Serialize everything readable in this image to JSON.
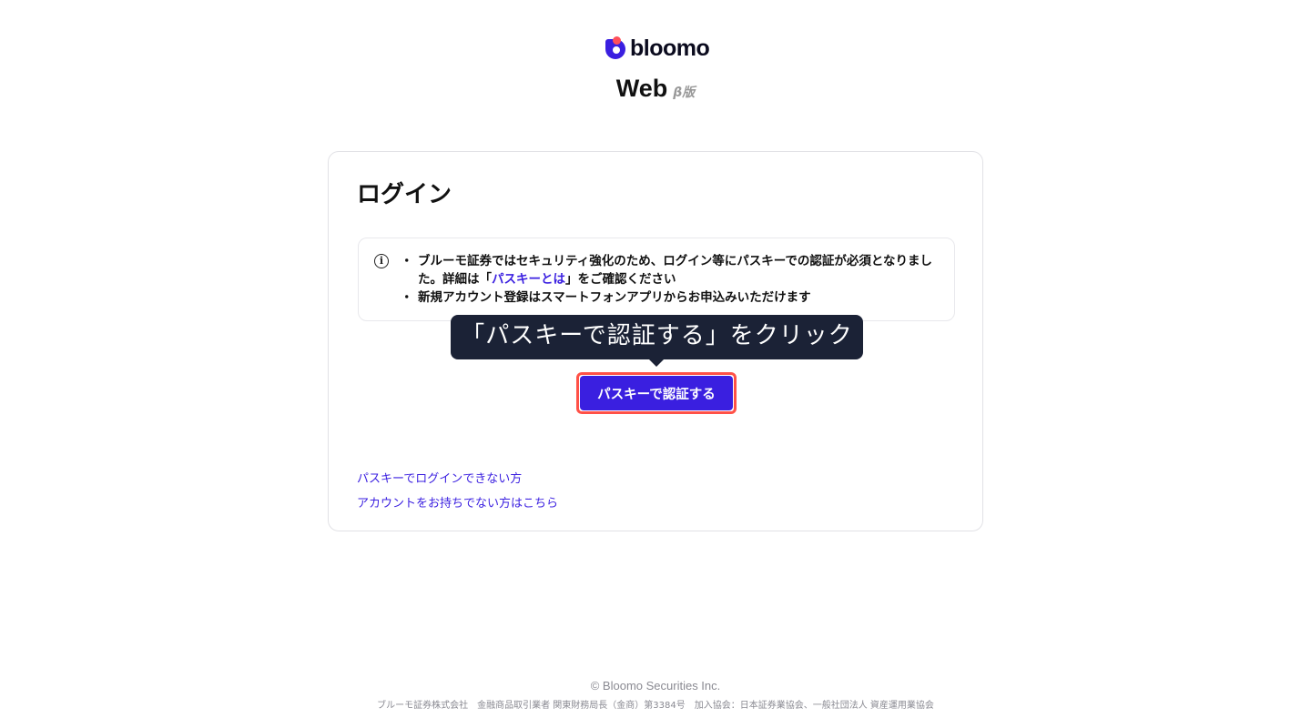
{
  "brand": {
    "logo_text": "bloomo",
    "logo_colors": {
      "primary": "#3a1fe0",
      "accent": "#ff4f5a"
    },
    "app_name": "Web",
    "app_badge": "β版"
  },
  "login": {
    "title": "ログイン",
    "notice": {
      "item1_text": "ブルーモ証券ではセキュリティ強化のため、ログイン等にパスキーでの認証が必須となりました。詳細は「",
      "item1_link": "パスキーとは",
      "item1_tail": "」をご確認ください",
      "item2_text": "新規アカウント登録はスマートフォンアプリからお申込みいただけます"
    },
    "tooltip": "「パスキーで認証する」をクリック",
    "passkey_button": "パスキーで認証する",
    "links": {
      "cannot_login": "パスキーでログインできない方",
      "no_account": "アカウントをお持ちでない方はこちら"
    }
  },
  "footer": {
    "copyright": "© Bloomo Securities Inc.",
    "legal": "ブルーモ証券株式会社　金融商品取引業者 関東財務局長（金商）第3384号　加入協会：日本証券業協会、一般社団法人 資産運用業協会"
  }
}
